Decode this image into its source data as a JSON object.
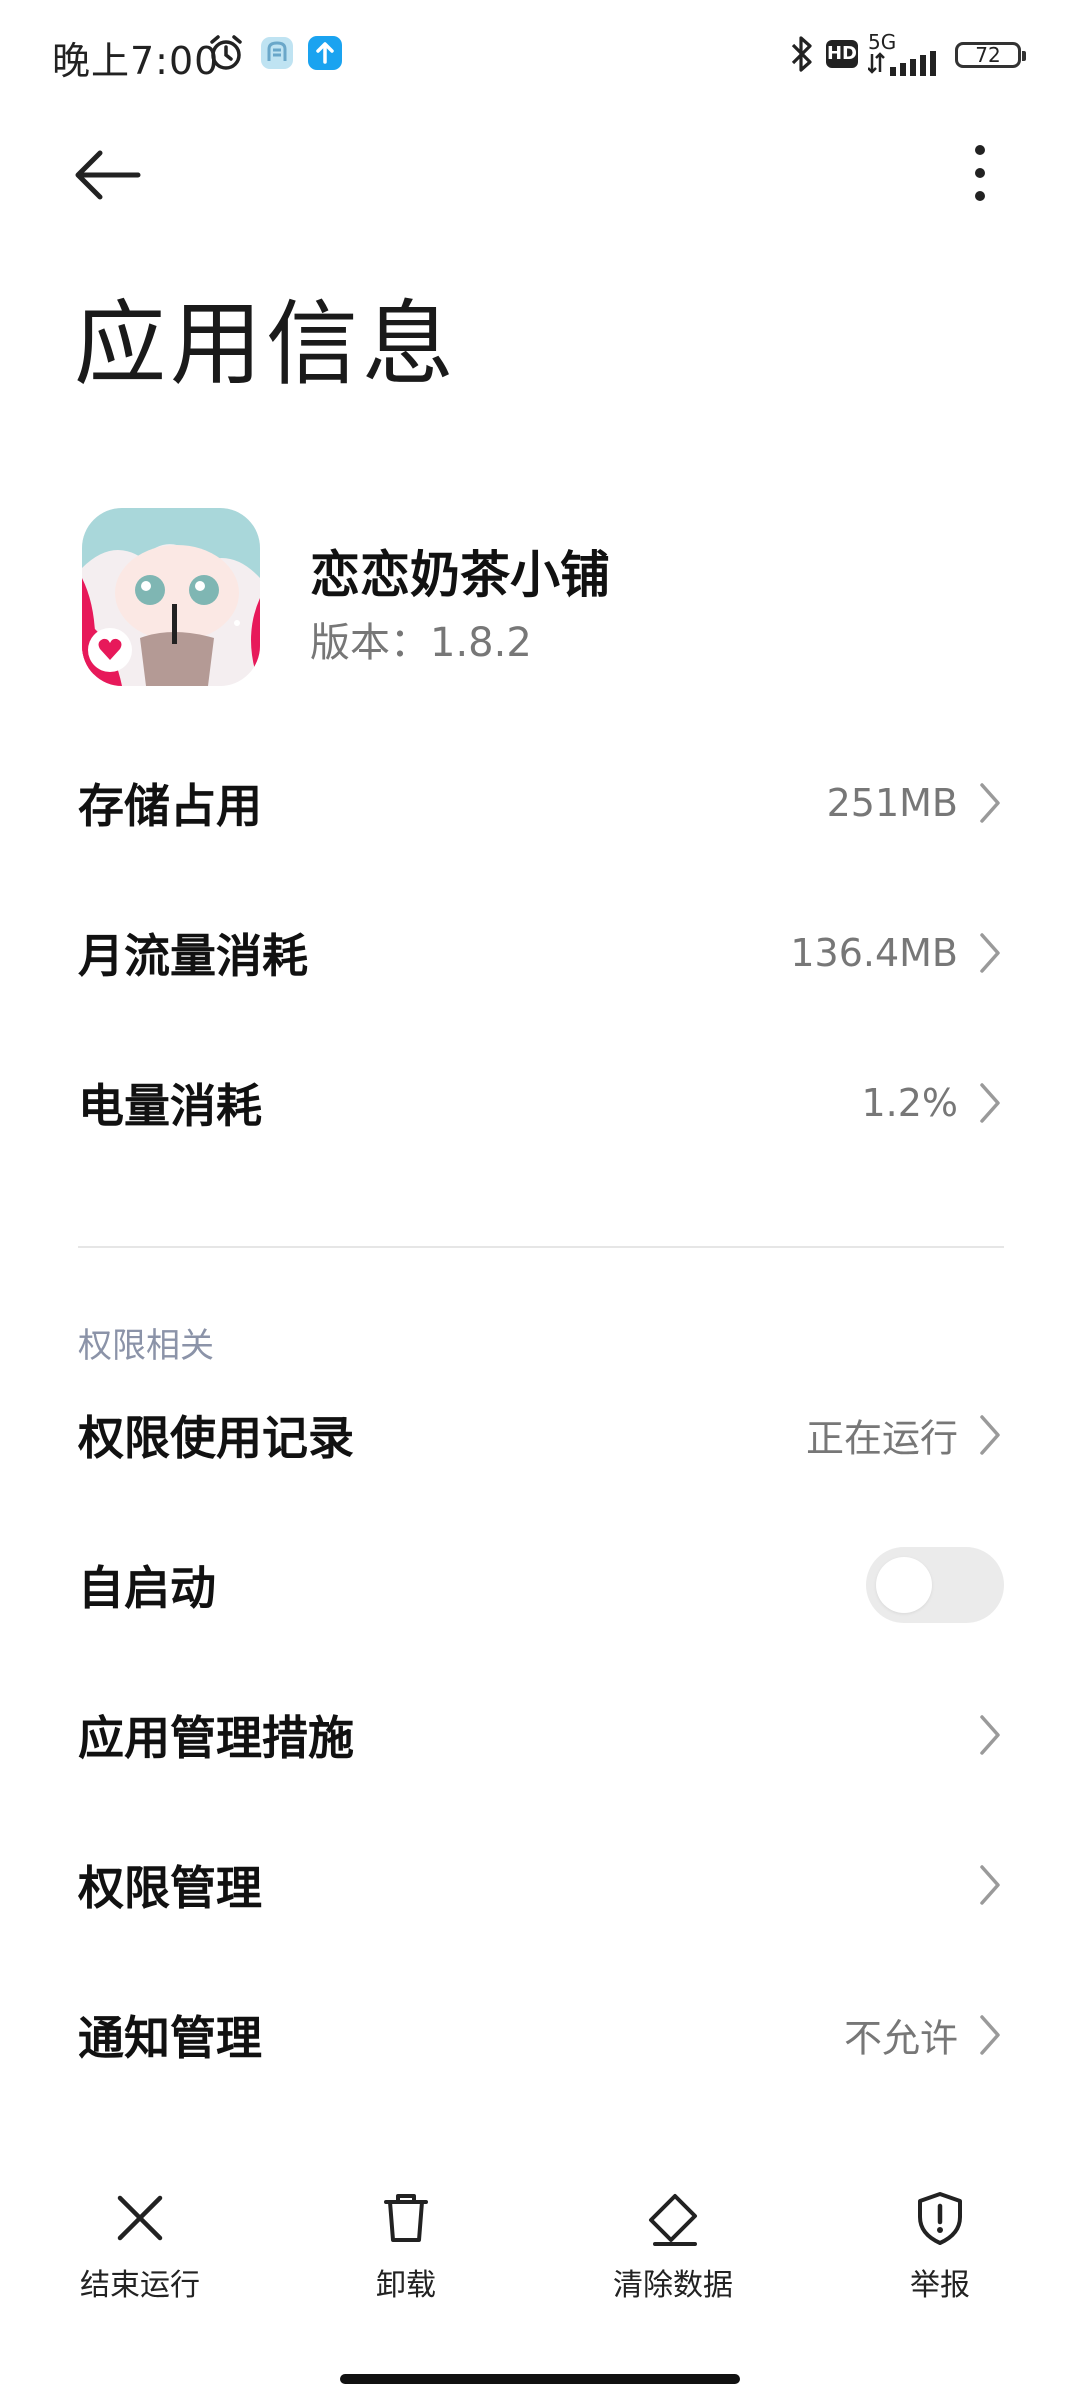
{
  "status_bar": {
    "time": "晚上7:00",
    "network": "5G",
    "hd_badge": "HD",
    "battery": "72"
  },
  "header": {
    "title": "应用信息"
  },
  "app": {
    "name": "恋恋奶茶小铺",
    "version": "版本：1.8.2"
  },
  "usage_rows": [
    {
      "label": "存储占用",
      "value": "251MB"
    },
    {
      "label": "月流量消耗",
      "value": "136.4MB"
    },
    {
      "label": "电量消耗",
      "value": "1.2%"
    }
  ],
  "permissions": {
    "section_title": "权限相关",
    "usage_record": {
      "label": "权限使用记录",
      "value": "正在运行"
    },
    "autostart": {
      "label": "自启动",
      "enabled": false
    },
    "app_management": {
      "label": "应用管理措施"
    },
    "permission_management": {
      "label": "权限管理"
    },
    "notification_management": {
      "label": "通知管理",
      "value": "不允许"
    }
  },
  "actions": {
    "force_stop": "结束运行",
    "uninstall": "卸载",
    "clear_data": "清除数据",
    "report": "举报"
  }
}
